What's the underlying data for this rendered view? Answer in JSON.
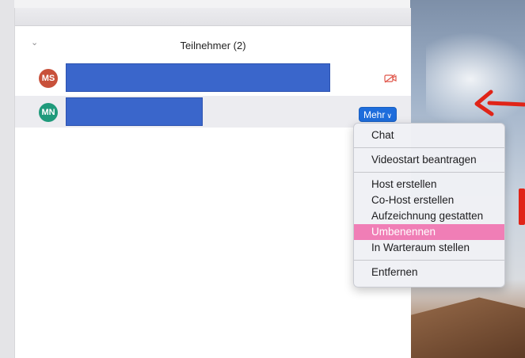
{
  "panel": {
    "title": "Teilnehmer (2)",
    "collapse_icon": "chevron-down-icon"
  },
  "participants": [
    {
      "initials": "MS",
      "color": "#c8513b",
      "status_icon": "video-off-icon",
      "name_redacted": true
    },
    {
      "initials": "MN",
      "color": "#1f9a7b",
      "name_redacted": true
    }
  ],
  "more_button": {
    "label": "Mehr",
    "icon": "chevron-down-icon",
    "color": "#1e6ddc"
  },
  "menu": {
    "groups": [
      [
        "Chat"
      ],
      [
        "Videostart beantragen"
      ],
      [
        "Host erstellen",
        "Co-Host erstellen",
        "Aufzeichnung gestatten",
        "Umbenennen",
        "In Warteraum stellen"
      ],
      [
        "Entfernen"
      ]
    ],
    "highlighted": "Umbenennen",
    "highlight_color": "#f07eb6"
  },
  "annotation_color": "#e02418"
}
